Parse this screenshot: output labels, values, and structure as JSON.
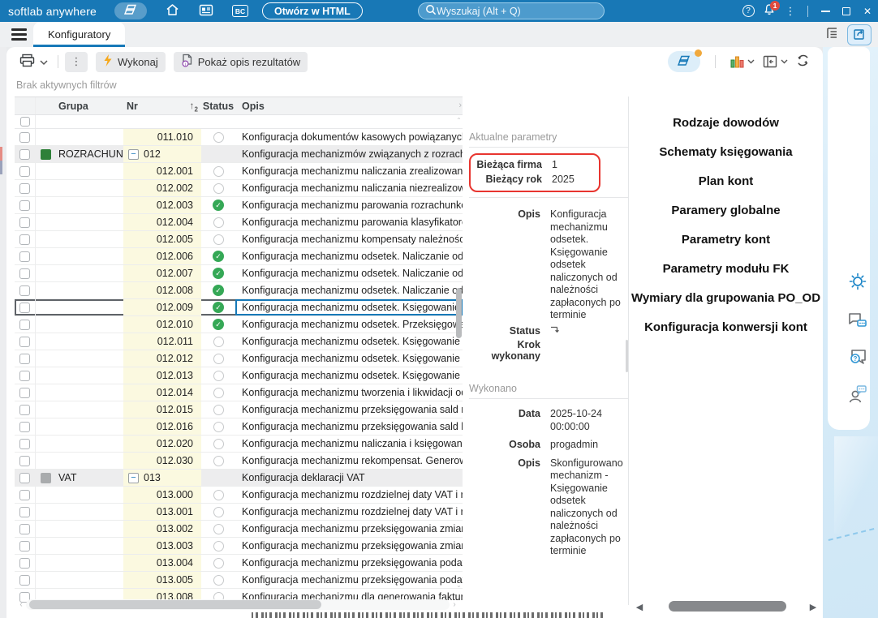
{
  "topbar": {
    "app_title": "softlab anywhere",
    "open_in_html_button": "Otwórz w HTML",
    "search_placeholder": "Wyszukaj (Alt + Q)",
    "notification_badge": "1"
  },
  "tabbar": {
    "tab_konfiguratory": "Konfiguratory"
  },
  "toolbar": {
    "execute_button": "Wykonaj",
    "show_results_button": "Pokaż opis rezultatów",
    "no_filters_text": "Brak aktywnych filtrów"
  },
  "table": {
    "headers": {
      "grupa": "Grupa",
      "nr": "Nr",
      "status": "Status",
      "opis": "Opis",
      "sort_arrow": "↑",
      "sort_level": "2"
    },
    "rows": [
      {
        "kind": "item",
        "grupa": "",
        "nr": "011.010",
        "status": "empty",
        "opis": "Konfiguracja dokumentów kasowych powiązanych z e"
      },
      {
        "kind": "group",
        "grupa": "ROZRACHUNKI",
        "swatch": "group_green",
        "nr": "012",
        "status": "",
        "opis": "Konfiguracja mechanizmów związanych z rozrachunka"
      },
      {
        "kind": "item",
        "grupa": "",
        "nr": "012.001",
        "status": "empty",
        "opis": "Konfiguracja mechanizmu naliczania zrealizowanych r"
      },
      {
        "kind": "item",
        "grupa": "",
        "nr": "012.002",
        "status": "empty",
        "opis": "Konfiguracja mechanizmu naliczania niezrealizowany"
      },
      {
        "kind": "item",
        "grupa": "",
        "nr": "012.003",
        "status": "done",
        "opis": "Konfiguracja mechanizmu parowania rozrachunków"
      },
      {
        "kind": "item",
        "grupa": "",
        "nr": "012.004",
        "status": "empty",
        "opis": "Konfiguracja mechanizmu parowania klasyfikatorów"
      },
      {
        "kind": "item",
        "grupa": "",
        "nr": "012.005",
        "status": "empty",
        "opis": "Konfiguracja mechanizmu kompensaty należności i zo"
      },
      {
        "kind": "item",
        "grupa": "",
        "nr": "012.006",
        "status": "done",
        "opis": "Konfiguracja mechanizmu odsetek.  Naliczanie odsete"
      },
      {
        "kind": "item",
        "grupa": "",
        "nr": "012.007",
        "status": "done",
        "opis": "Konfiguracja mechanizmu odsetek.  Naliczanie odsete"
      },
      {
        "kind": "item",
        "grupa": "",
        "nr": "012.008",
        "status": "done",
        "opis": "Konfiguracja mechanizmu odsetek.  Naliczanie odsete"
      },
      {
        "kind": "item",
        "grupa": "",
        "nr": "012.009",
        "status": "done",
        "opis": "Konfiguracja mechanizmu odsetek.  Księgowanie odse",
        "selected": true
      },
      {
        "kind": "item",
        "grupa": "",
        "nr": "012.010",
        "status": "done",
        "opis": "Konfiguracja mechanizmu odsetek. Przeksięgowanie"
      },
      {
        "kind": "item",
        "grupa": "",
        "nr": "012.011",
        "status": "empty",
        "opis": "Konfiguracja mechanizmu odsetek.  Księgowanie odse"
      },
      {
        "kind": "item",
        "grupa": "",
        "nr": "012.012",
        "status": "empty",
        "opis": "Konfiguracja mechanizmu odsetek.  Księgowanie odse"
      },
      {
        "kind": "item",
        "grupa": "",
        "nr": "012.013",
        "status": "empty",
        "opis": "Konfiguracja mechanizmu odsetek.  Księgowanie odse"
      },
      {
        "kind": "item",
        "grupa": "",
        "nr": "012.014",
        "status": "empty",
        "opis": "Konfiguracja mechanizmu tworzenia i likwidacji odpis"
      },
      {
        "kind": "item",
        "grupa": "",
        "nr": "012.015",
        "status": "empty",
        "opis": "Konfiguracja mechanizmu przeksięgowania sald rozra"
      },
      {
        "kind": "item",
        "grupa": "",
        "nr": "012.016",
        "status": "empty",
        "opis": "Konfiguracja mechanizmu przeksięgowania sald klasy"
      },
      {
        "kind": "item",
        "grupa": "",
        "nr": "012.020",
        "status": "empty",
        "opis": "Konfiguracja mechanizmu naliczania i księgowania wy"
      },
      {
        "kind": "item",
        "grupa": "",
        "nr": "012.030",
        "status": "empty",
        "opis": "Konfiguracja mechanizmu rekompensat. Generowanie"
      },
      {
        "kind": "group",
        "grupa": "VAT",
        "swatch": "group_gray",
        "nr": "013",
        "status": "",
        "opis": "Konfiguracja deklaracji VAT"
      },
      {
        "kind": "item",
        "grupa": "",
        "nr": "013.000",
        "status": "empty",
        "opis": "Konfiguracja mechanizmu rozdzielnej daty VAT i rozdz"
      },
      {
        "kind": "item",
        "grupa": "",
        "nr": "013.001",
        "status": "empty",
        "opis": "Konfiguracja mechanizmu rozdzielnej daty VAT  i rozd"
      },
      {
        "kind": "item",
        "grupa": "",
        "nr": "013.002",
        "status": "empty",
        "opis": "Konfiguracja mechanizmu przeksięgowania zmiany da"
      },
      {
        "kind": "item",
        "grupa": "",
        "nr": "013.003",
        "status": "empty",
        "opis": "Konfiguracja mechanizmu przeksięgowania zmiany da"
      },
      {
        "kind": "item",
        "grupa": "",
        "nr": "013.004",
        "status": "empty",
        "opis": "Konfiguracja mechanizmu przeksięgowania podatku V"
      },
      {
        "kind": "item",
        "grupa": "",
        "nr": "013.005",
        "status": "empty",
        "opis": "Konfiguracja mechanizmu przeksięgowania podatku V"
      },
      {
        "kind": "item",
        "grupa": "",
        "nr": "013.008",
        "status": "empty",
        "opis": "Konfiguracja mechanizmu dla generowania faktur/dok"
      }
    ]
  },
  "details": {
    "current_params_header": "Aktualne parametry",
    "firma_label": "Bieżąca firma",
    "firma_value": "1",
    "rok_label": "Bieżący rok",
    "rok_value": "2025",
    "opis_label": "Opis",
    "opis_value": "Konfiguracja mechanizmu odsetek.  Księgowanie odsetek naliczonych od należności zapłaconych po terminie",
    "status_label": "Status",
    "krok_label": "Krok wykonany",
    "wykonano_header": "Wykonano",
    "data_label": "Data",
    "data_value": "2025-10-24 00:00:00",
    "osoba_label": "Osoba",
    "osoba_value": "progadmin",
    "wyk_opis_label": "Opis",
    "wyk_opis_value": "Skonfigurowano mechanizm - Księgowanie odsetek naliczonych od należności zapłaconych po terminie"
  },
  "links_panel": {
    "items": [
      "Rodzaje dowodów",
      "Schematy księgowania",
      "Plan kont",
      "Paramery globalne",
      "Parametry kont",
      "Parametry modułu FK",
      "Wymiary dla grupowania PO_OD",
      "Konfiguracja konwersji kont"
    ]
  },
  "colors": {
    "topbar_blue": "#1878b6",
    "topbar_search_bg": "#4d9bcd",
    "accent_blue": "#1779b8",
    "tabbar_gray": "#eef0f2",
    "button_gray": "#e9eaec",
    "done_green": "#35a856",
    "group_green": "#2e8038",
    "group_gray": "#a9abad",
    "annotation_red": "#e8352f",
    "nr_yellow": "#fbf9e0",
    "row_group_bg": "#ededee",
    "selection_dark": "#5f6368",
    "link_text": "#111111",
    "bolt_orange": "#f6a81c"
  }
}
